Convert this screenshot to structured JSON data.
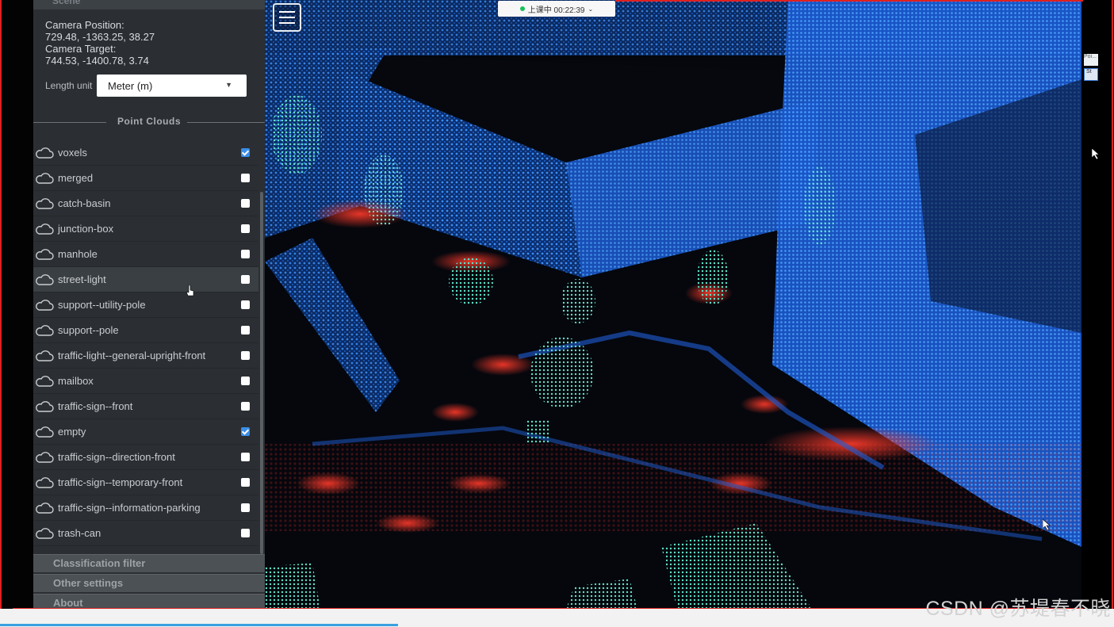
{
  "sidebar": {
    "top_section_label": "Scene",
    "camera": {
      "position_label": "Camera Position:",
      "position_value": "729.48, -1363.25, 38.27",
      "target_label": "Camera Target:",
      "target_value": "744.53, -1400.78, 3.74"
    },
    "length_unit": {
      "label": "Length unit",
      "value": "Meter (m)"
    },
    "point_clouds_header": "Point Clouds",
    "point_clouds": [
      {
        "label": "voxels",
        "checked": true
      },
      {
        "label": "merged",
        "checked": false
      },
      {
        "label": "catch-basin",
        "checked": false
      },
      {
        "label": "junction-box",
        "checked": false
      },
      {
        "label": "manhole",
        "checked": false
      },
      {
        "label": "street-light",
        "checked": false
      },
      {
        "label": "support--utility-pole",
        "checked": false
      },
      {
        "label": "support--pole",
        "checked": false
      },
      {
        "label": "traffic-light--general-upright-front",
        "checked": false
      },
      {
        "label": "mailbox",
        "checked": false
      },
      {
        "label": "traffic-sign--front",
        "checked": false
      },
      {
        "label": "empty",
        "checked": true
      },
      {
        "label": "traffic-sign--direction-front",
        "checked": false
      },
      {
        "label": "traffic-sign--temporary-front",
        "checked": false
      },
      {
        "label": "traffic-sign--information-parking",
        "checked": false
      },
      {
        "label": "trash-can",
        "checked": false
      }
    ],
    "accordions": [
      "Classification filter",
      "Other settings",
      "About"
    ]
  },
  "meeting_bar": {
    "text": "上课中 00:22:39"
  },
  "side_mini": {
    "item1": "Poi...",
    "item2": "St"
  },
  "watermark": "CSDN @苏堤春不晓",
  "colors": {
    "accent": "#3b8ee8",
    "sidebar_bg": "#2b2f33",
    "cloud_blue": "#2b7bf0",
    "cloud_red": "#e0302a",
    "cloud_cyan": "#5fe3c8"
  }
}
